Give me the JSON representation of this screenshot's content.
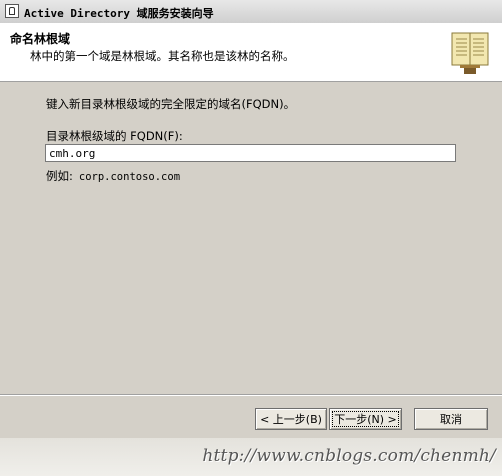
{
  "window": {
    "title": "Active Directory 域服务安装向导",
    "icon": "wizard-app-icon"
  },
  "header": {
    "title": "命名林根域",
    "subtitle": "林中的第一个域是林根域。其名称也是该林的名称。",
    "icon": "book-icon"
  },
  "main": {
    "instruction": "键入新目录林根级域的完全限定的域名(FQDN)。",
    "fqdn_label": "目录林根级域的 FQDN(F):",
    "fqdn_value": "cmh.org",
    "example_label": "例如:",
    "example_value": "corp.contoso.com"
  },
  "buttons": {
    "back": "< 上一步(B)",
    "next": "下一步(N) >",
    "cancel": "取消"
  },
  "watermark": "http://www.cnblogs.com/chenmh/"
}
